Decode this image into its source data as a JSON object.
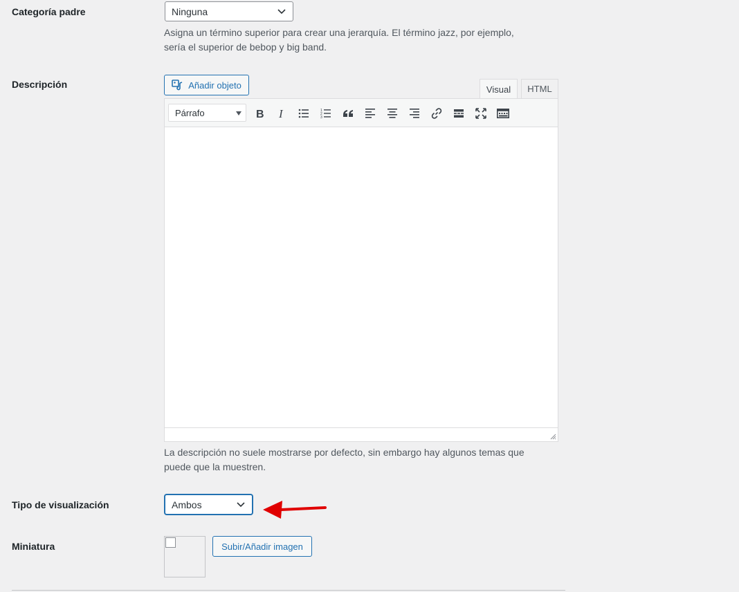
{
  "parent_category": {
    "label": "Categoría padre",
    "selected": "Ninguna",
    "help_line1": "Asigna un término superior para crear una jerarquía. El término jazz, por ejemplo,",
    "help_line2": "sería el superior de bebop y big band."
  },
  "description": {
    "label": "Descripción",
    "add_media_label": "Añadir objeto",
    "tabs": {
      "visual": "Visual",
      "html": "HTML"
    },
    "format_select": "Párrafo",
    "toolbar_icons": [
      "bold-icon",
      "italic-icon",
      "bullet-list-icon",
      "numbered-list-icon",
      "blockquote-icon",
      "align-left-icon",
      "align-center-icon",
      "align-right-icon",
      "link-icon",
      "read-more-icon",
      "fullscreen-icon",
      "toolbar-toggle-icon"
    ],
    "help_line1": "La descripción no suele mostrarse por defecto, sin embargo hay algunos temas que",
    "help_line2": "puede que la muestren."
  },
  "display_type": {
    "label": "Tipo de visualización",
    "selected": "Ambos"
  },
  "thumbnail": {
    "label": "Miniatura",
    "upload_label": "Subir/Añadir imagen"
  },
  "colors": {
    "accent": "#2271b1",
    "annotation_arrow": "#e00000",
    "background": "#f0f0f1"
  }
}
